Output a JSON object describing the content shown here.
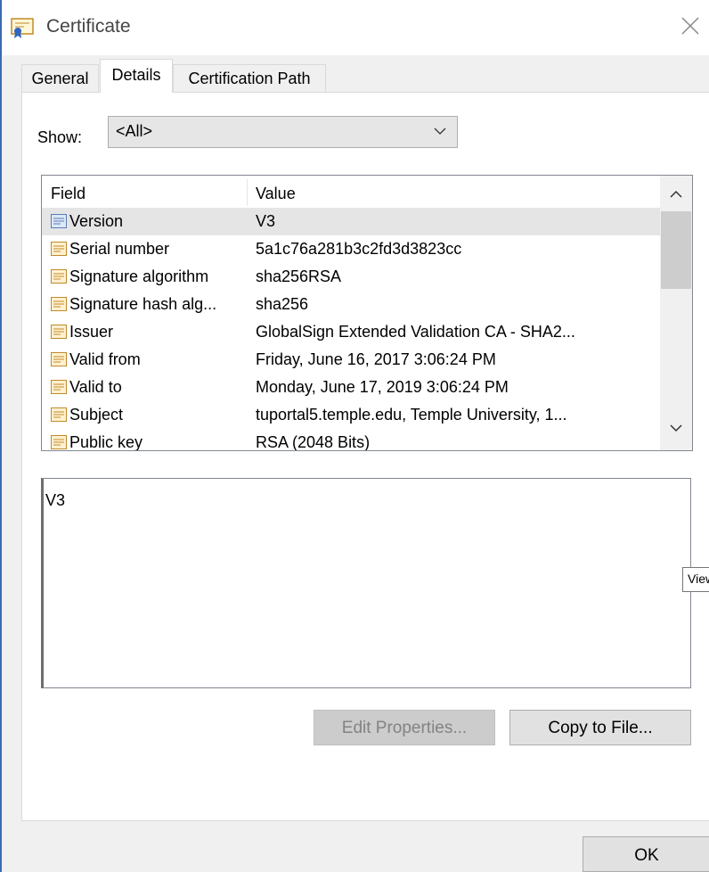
{
  "window": {
    "title": "Certificate"
  },
  "tabs": [
    {
      "label": "General"
    },
    {
      "label": "Details",
      "active": true
    },
    {
      "label": "Certification Path"
    }
  ],
  "show": {
    "label": "Show:",
    "value": "<All>"
  },
  "list": {
    "headers": {
      "field": "Field",
      "value": "Value"
    },
    "rows": [
      {
        "field": "Version",
        "value": "V3",
        "selected": true
      },
      {
        "field": "Serial number",
        "value": "5a1c76a281b3c2fd3d3823cc"
      },
      {
        "field": "Signature algorithm",
        "value": "sha256RSA"
      },
      {
        "field": "Signature hash alg...",
        "value": "sha256"
      },
      {
        "field": "Issuer",
        "value": "GlobalSign Extended Validation CA - SHA2..."
      },
      {
        "field": "Valid from",
        "value": "Friday, June 16, 2017 3:06:24 PM"
      },
      {
        "field": "Valid to",
        "value": "Monday, June 17, 2019 3:06:24 PM"
      },
      {
        "field": "Subject",
        "value": "tuportal5.temple.edu, Temple University, 1..."
      },
      {
        "field": "Public key",
        "value": "RSA (2048 Bits)"
      }
    ]
  },
  "detail": {
    "text": "V3"
  },
  "tooltip": {
    "text": "View"
  },
  "buttons": {
    "edit_properties": "Edit Properties...",
    "copy_to_file": "Copy to File...",
    "ok": "OK"
  },
  "icons": {
    "title": "certificate-icon",
    "row": "certificate-field-icon",
    "close": "close-icon"
  },
  "colors": {
    "window_border": "#3c6ab3",
    "selection": "#e5e5e5",
    "disabled_text": "#838383"
  }
}
